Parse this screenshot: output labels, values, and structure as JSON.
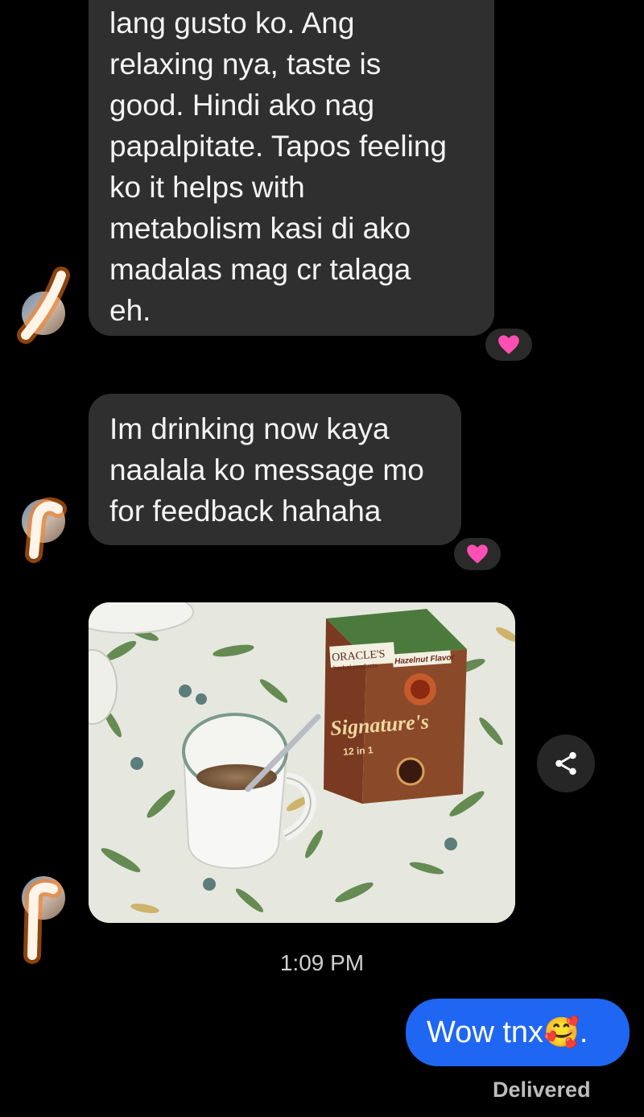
{
  "messages": {
    "received_1": {
      "lines": [
        "lang gusto ko. Ang",
        "relaxing nya, taste is",
        "good. Hindi ako nag",
        "papalpitate. Tapos feeling",
        "ko it helps with",
        "metabolism kasi di ako",
        "madalas mag cr talaga",
        "eh."
      ],
      "reaction": "heart"
    },
    "received_2": {
      "lines": [
        "Im drinking now kaya",
        "naalala ko message mo",
        "for feedback hahaha"
      ],
      "reaction": "heart"
    },
    "photo": {
      "box_brand": "ORACLE'S",
      "box_sub": "herbal products",
      "box_flavor": "Hazelnut Flavor",
      "box_name": "Signature's",
      "box_variant": "12 in 1"
    },
    "timestamp": "1:09 PM",
    "sent": {
      "text": "Wow tnx",
      "emoji": "🥰",
      "trailing": "."
    },
    "status": "Delivered"
  },
  "colors": {
    "background": "#000000",
    "received_bubble": "#2f2f2f",
    "sent_bubble": "#1f66f2",
    "reaction_heart": "#ff4fb3",
    "scribble": "#ff7a18"
  },
  "icons": {
    "share": "share-icon",
    "reaction": "heart-icon"
  }
}
